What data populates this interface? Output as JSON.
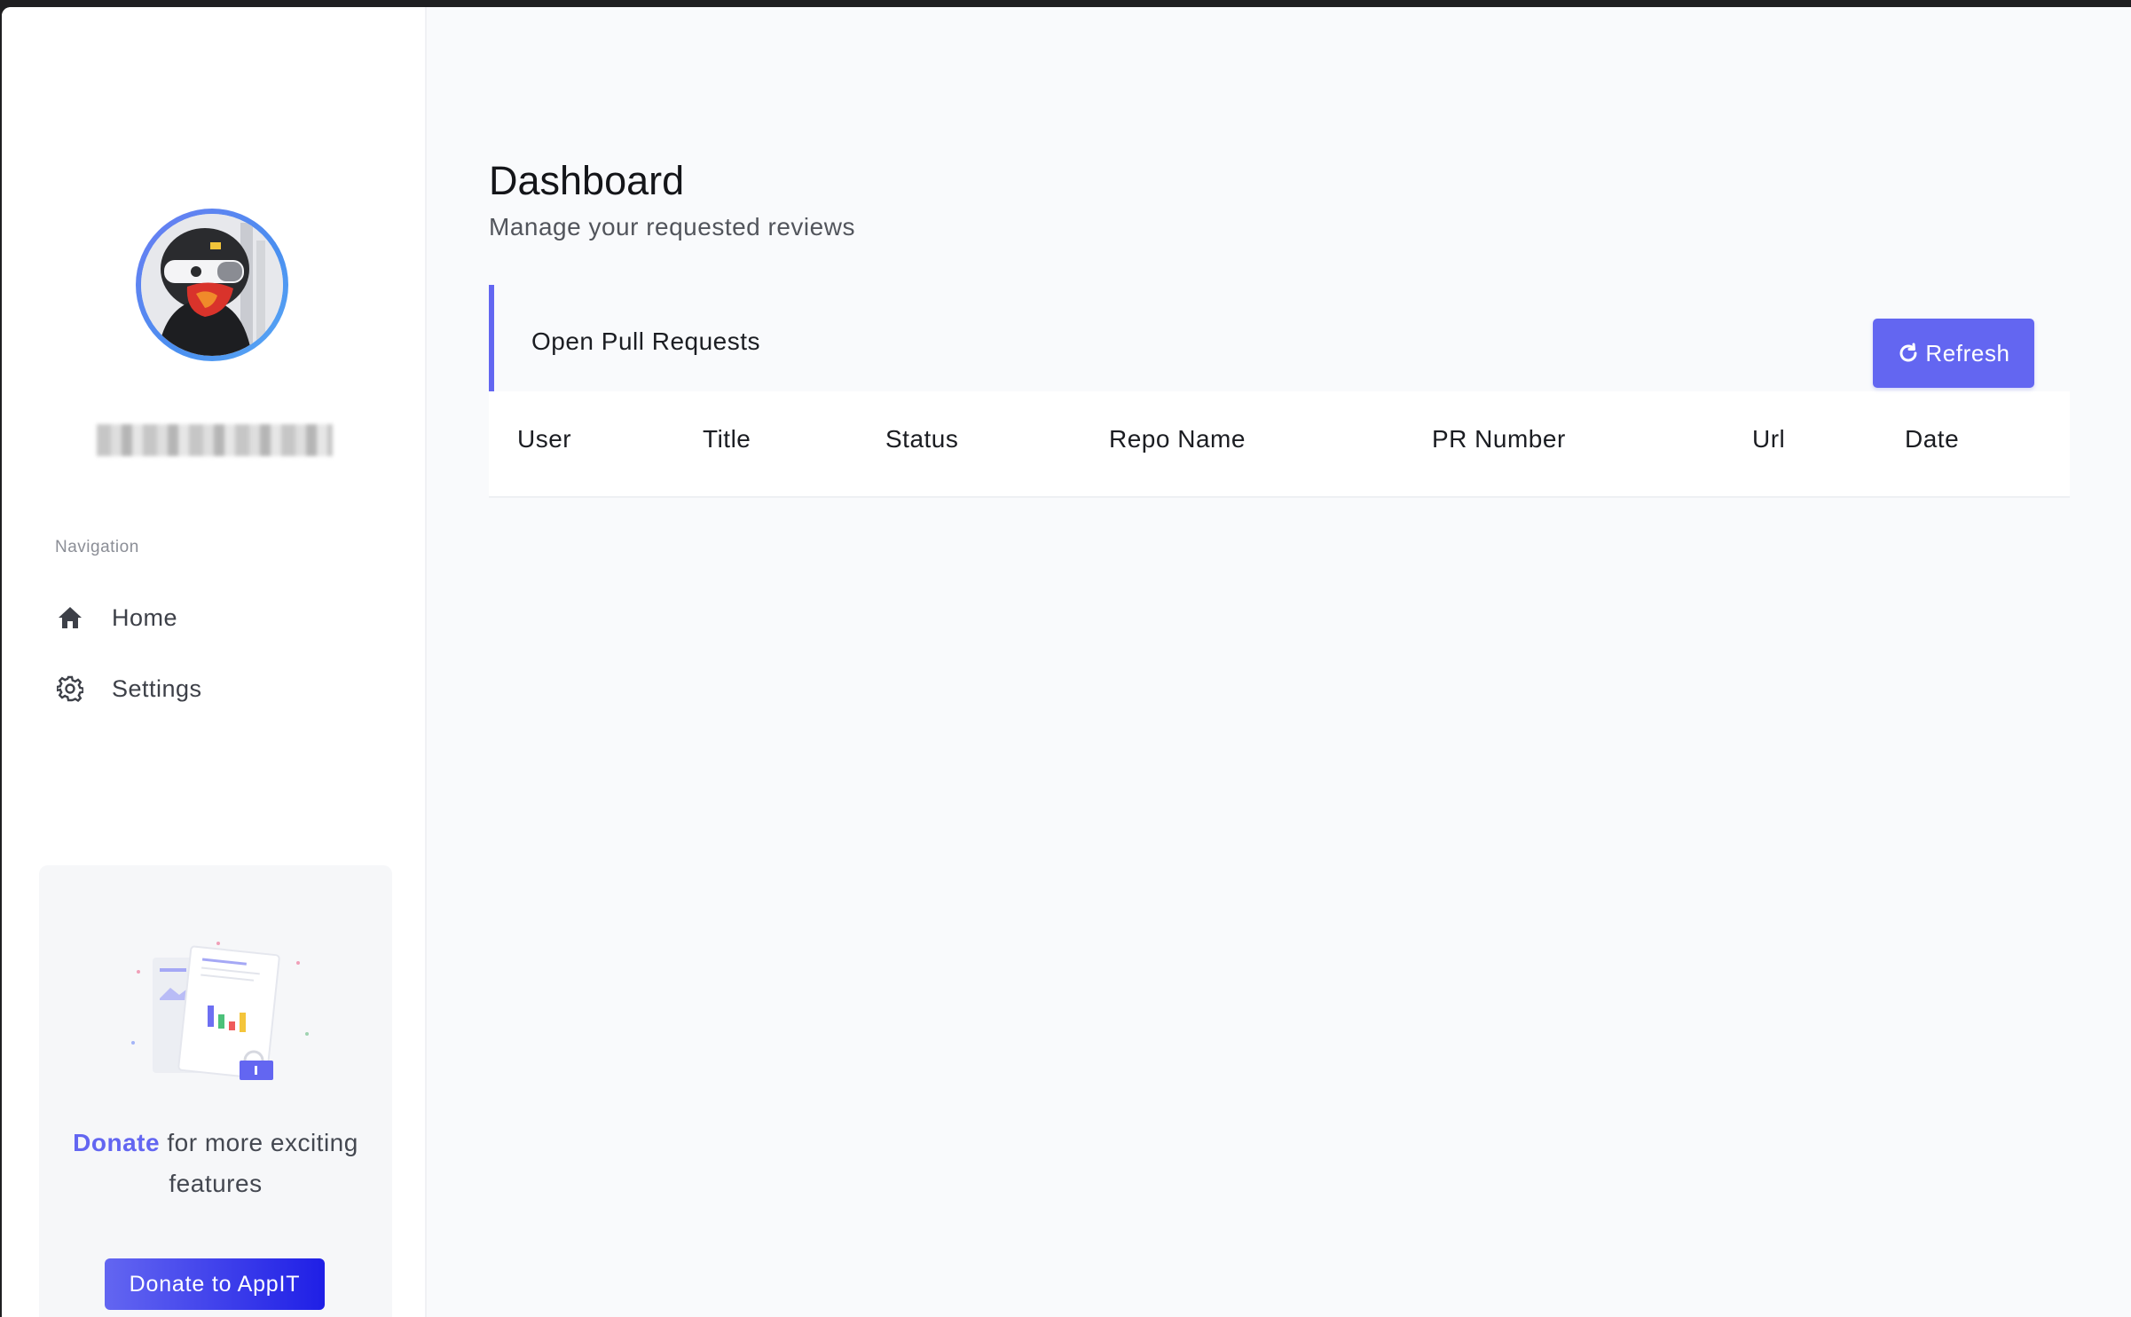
{
  "sidebar": {
    "nav_label": "Navigation",
    "items": [
      {
        "label": "Home",
        "icon": "home-icon"
      },
      {
        "label": "Settings",
        "icon": "gear-icon"
      }
    ],
    "donate": {
      "highlight": "Donate",
      "text": "for more exciting features",
      "button_label": "Donate to AppIT"
    }
  },
  "main": {
    "title": "Dashboard",
    "subtitle": "Manage your requested reviews",
    "panel": {
      "title": "Open Pull Requests",
      "refresh_label": "Refresh",
      "refresh_icon": "refresh-icon",
      "columns": [
        "User",
        "Title",
        "Status",
        "Repo Name",
        "PR Number",
        "Url",
        "Date"
      ],
      "rows": []
    }
  },
  "colors": {
    "accent": "#6366f1",
    "background": "#f9fafc",
    "sidebar": "#ffffff"
  }
}
